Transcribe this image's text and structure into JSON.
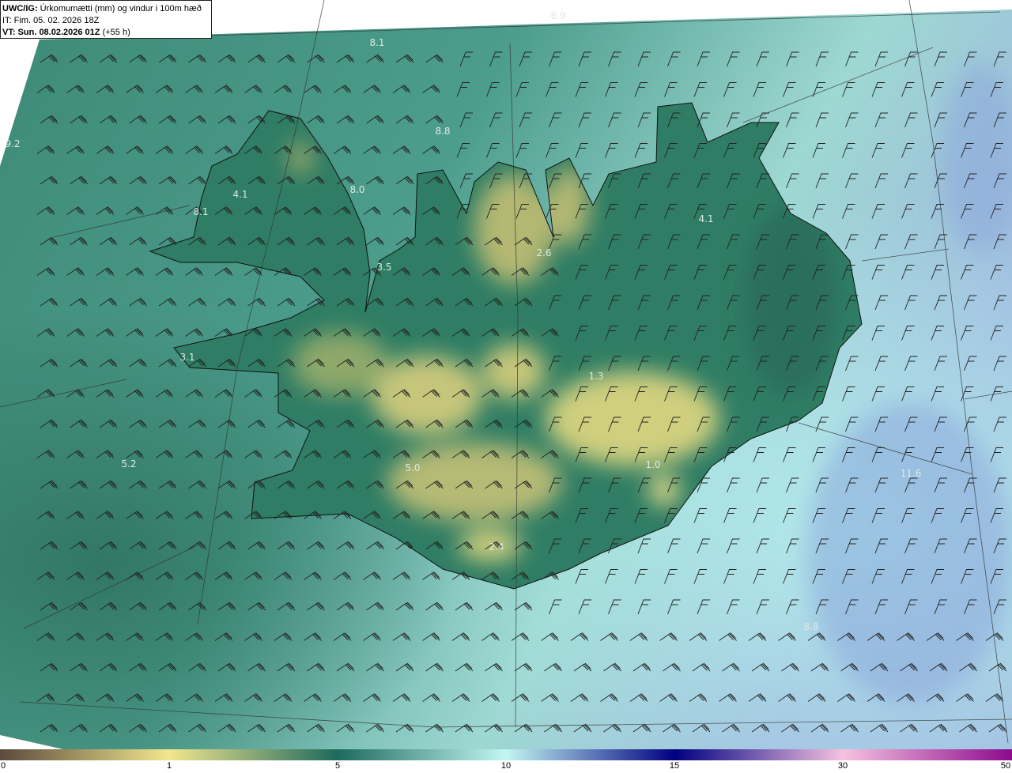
{
  "header": {
    "model": "UWC/IG:",
    "title": "Úrkomumætti (mm) og vindur i 100m hæð",
    "it_line": "IT: Fim. 05. 02. 2026 18Z",
    "vt_bold": "VT: Sun. 08.02.2026 01Z",
    "vt_offset": "(+55 h)"
  },
  "map_labels": [
    {
      "text": "6.9"
    },
    {
      "text": "8.1"
    },
    {
      "text": "9.2"
    },
    {
      "text": "8.8"
    },
    {
      "text": "4.1"
    },
    {
      "text": "8.1"
    },
    {
      "text": "8.0"
    },
    {
      "text": "3.5"
    },
    {
      "text": "2.6"
    },
    {
      "text": "4.1"
    },
    {
      "text": "3.1"
    },
    {
      "text": "5.2"
    },
    {
      "text": "5.0"
    },
    {
      "text": "2.4"
    },
    {
      "text": "1.3"
    },
    {
      "text": "1.0"
    },
    {
      "text": "11.6"
    },
    {
      "text": "8.8"
    }
  ],
  "colorbar": {
    "ticks": [
      "0",
      "1",
      "5",
      "10",
      "15",
      "30",
      "50"
    ],
    "colors": [
      "#5c4a3c",
      "#f2e68e",
      "#1d6a5c",
      "#c2f6f2",
      "#000080",
      "#f6c2e0",
      "#8c0a8c"
    ]
  },
  "colors": {
    "sea": "#4f9e8e",
    "land_low": "#2e7a62",
    "land_dry": "#c8c878",
    "coast": "#111111"
  }
}
